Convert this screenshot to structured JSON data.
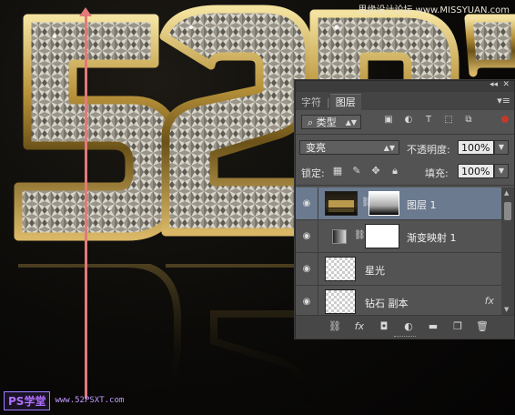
{
  "watermark": {
    "top_right": "思缘设计论坛 www.MISSYUAN.com",
    "bottom_logo": "PS学堂",
    "bottom_url": "www.52PSXT.com"
  },
  "artwork": {
    "characters": [
      "5",
      "2",
      "P",
      "S"
    ],
    "accent_color": "#c9a64b",
    "guide_color": "#e27a7a"
  },
  "panel": {
    "tabs": [
      {
        "label": "字符"
      },
      {
        "label": "图层",
        "active": true
      }
    ],
    "filter": {
      "kind_label": "类型"
    },
    "blend_mode": "变亮",
    "opacity_label": "不透明度:",
    "opacity_value": "100%",
    "lock_label": "锁定:",
    "fill_label": "填充:",
    "fill_value": "100%",
    "layers": [
      {
        "name": "图层 1",
        "selected": true,
        "visible": true,
        "has_mask": true
      },
      {
        "name": "渐变映射 1",
        "selected": false,
        "visible": true,
        "adjustment": true
      },
      {
        "name": "星光",
        "selected": false,
        "visible": true
      },
      {
        "name": "钻石 副本",
        "selected": false,
        "visible": true,
        "fx": "fx"
      }
    ],
    "footer_fx": "fx"
  }
}
